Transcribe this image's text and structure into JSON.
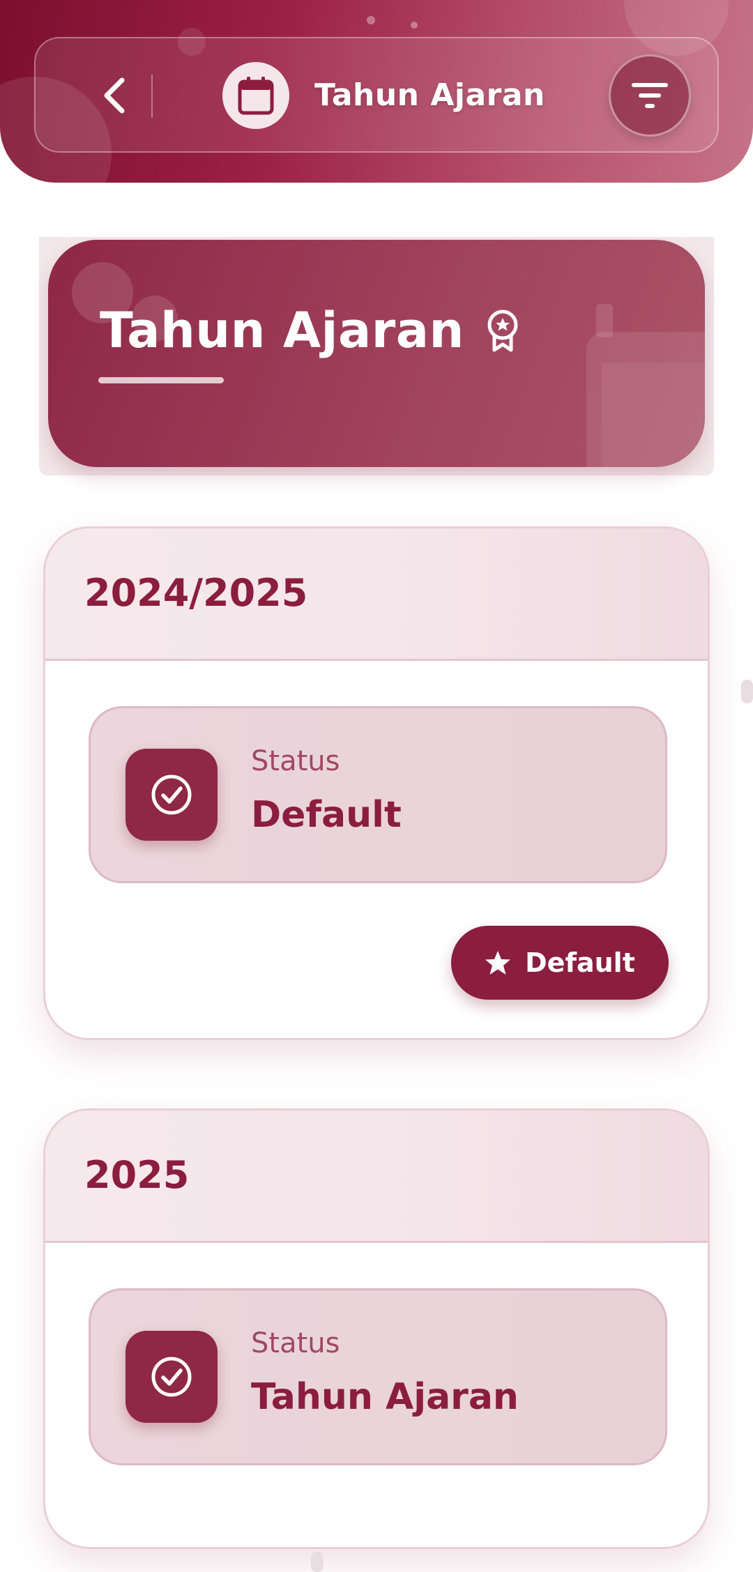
{
  "header": {
    "title": "Tahun Ajaran",
    "back_icon": "chevron-left-icon",
    "badge_icon": "calendar-icon",
    "filter_icon": "filter-icon"
  },
  "hero": {
    "title": "Tahun Ajaran",
    "icon": "award-icon"
  },
  "cards": [
    {
      "year": "2024/2025",
      "status_label": "Status",
      "status_value": "Default",
      "status_icon": "check-circle-icon",
      "action_label": "Default",
      "action_icon": "star-icon"
    },
    {
      "year": "2025",
      "status_label": "Status",
      "status_value": "Tahun Ajaran",
      "status_icon": "check-circle-icon"
    }
  ],
  "colors": {
    "primary": "#8b1d40",
    "header_gradient_start": "#7c0f2e",
    "header_gradient_end": "#c77387",
    "card_border": "#e8cfd6",
    "status_box_bg": "#ecd5dc"
  }
}
